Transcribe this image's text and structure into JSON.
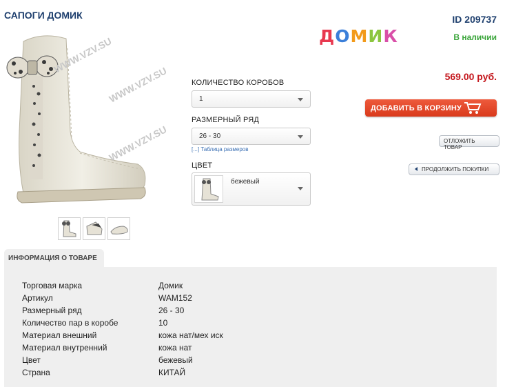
{
  "product": {
    "title": "САПОГИ ДОМИК",
    "id_label": "ID 209737",
    "stock_status": "В наличии",
    "price": "569.00 руб."
  },
  "brand": {
    "letters": [
      "Д",
      "О",
      "М",
      "И",
      "К"
    ],
    "letter_colors": [
      "#e8384f",
      "#3b7fd9",
      "#f29a1a",
      "#8cc63f",
      "#d94fa8"
    ]
  },
  "options": {
    "boxes_label": "КОЛИЧЕСТВО КОРОБОВ",
    "boxes_value": "1",
    "size_label": "РАЗМЕРНЫЙ РЯД",
    "size_value": "26 - 30",
    "size_table_link": "[...] Таблица размеров",
    "color_label": "ЦВЕТ",
    "color_value": "бежевый"
  },
  "actions": {
    "add_to_cart": "ДОБАВИТЬ В КОРЗИНУ",
    "postpone": "ОТЛОЖИТЬ ТОВАР",
    "continue_shopping": "ПРОДОЛЖИТЬ ПОКУПКИ"
  },
  "watermark": "WWW.VZV.SU",
  "info": {
    "tab_label": "ИНФОРМАЦИЯ О ТОВАРЕ",
    "rows": [
      {
        "label": "Торговая марка",
        "value": "Домик"
      },
      {
        "label": "Артикул",
        "value": "WAM152"
      },
      {
        "label": "Размерный ряд",
        "value": "26 - 30"
      },
      {
        "label": "Количество пар в коробе",
        "value": "10"
      },
      {
        "label": "Материал внешний",
        "value": "кожа нат/мех иск"
      },
      {
        "label": "Материал внутренний",
        "value": "кожа нат"
      },
      {
        "label": "Цвет",
        "value": "бежевый"
      },
      {
        "label": "Страна",
        "value": "КИТАЙ"
      }
    ]
  },
  "colors": {
    "heading": "#1e3f6e",
    "in_stock": "#3aa53a",
    "price": "#c4161c",
    "cart_button": "#e04a2b",
    "info_bg": "#efefef"
  },
  "icons": [
    "boot-image",
    "cart-icon",
    "arrow-left-icon",
    "chevron-down-icon"
  ]
}
